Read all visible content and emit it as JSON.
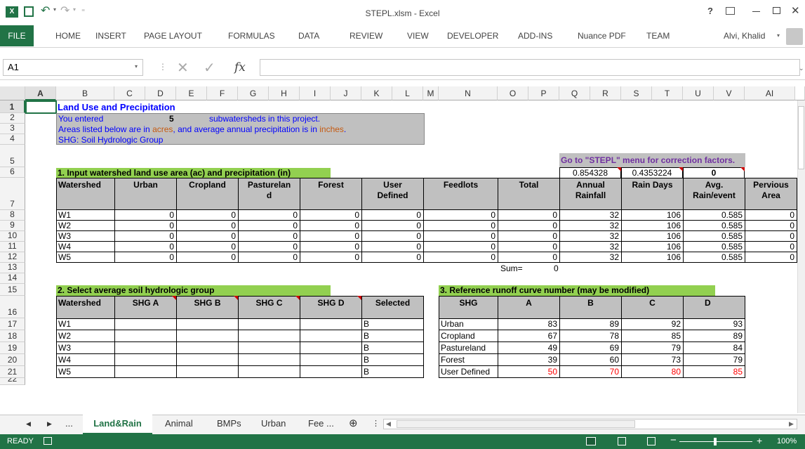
{
  "window": {
    "title": "STEPL.xlsm - Excel",
    "user": "Alvi, Khalid"
  },
  "ribbon": {
    "tabs": [
      "FILE",
      "HOME",
      "INSERT",
      "PAGE LAYOUT",
      "FORMULAS",
      "DATA",
      "REVIEW",
      "VIEW",
      "DEVELOPER",
      "ADD-INS",
      "Nuance PDF",
      "TEAM"
    ]
  },
  "formula_bar": {
    "name_box": "A1",
    "fx": "fx",
    "formula": ""
  },
  "columns": [
    "A",
    "B",
    "C",
    "D",
    "E",
    "F",
    "G",
    "H",
    "I",
    "J",
    "K",
    "L",
    "M",
    "N",
    "O",
    "P",
    "Q",
    "R",
    "S",
    "T",
    "U",
    "V",
    "AI"
  ],
  "rows": [
    "1",
    "2",
    "3",
    "4",
    "5",
    "6",
    "7",
    "8",
    "9",
    "10",
    "11",
    "12",
    "13",
    "14",
    "15",
    "16",
    "17",
    "18",
    "19",
    "20",
    "21",
    "22"
  ],
  "sheet": {
    "title": "Land Use and Precipitation",
    "entered_prefix": "You entered",
    "entered_count": "5",
    "entered_suffix": "subwatersheds in this project.",
    "areas_a": "Areas listed below are in ",
    "areas_b": "acres",
    "areas_c": ", and average annual precipitation is in ",
    "areas_d": "inches",
    "areas_e": ".",
    "shg_note": "SHG: Soil Hydrologic Group",
    "goto_note": "Go to \"STEPL\" menu for correction factors.",
    "factors": [
      "0.854328",
      "0.4353224",
      "0"
    ],
    "section1_title": "1. Input watershed land use area (ac) and precipitation",
    "section1_unit": "(in)",
    "t1_headers": [
      "Watershed",
      "Urban",
      "Cropland",
      "Pasturelan d",
      "Forest",
      "User Defined",
      "Feedlots",
      "Total",
      "Annual Rainfall",
      "Rain Days",
      "Avg. Rain/event",
      "Pervious Area"
    ],
    "t1_rows": [
      [
        "W1",
        "0",
        "0",
        "0",
        "0",
        "0",
        "0",
        "0",
        "32",
        "106",
        "0.585",
        "0"
      ],
      [
        "W2",
        "0",
        "0",
        "0",
        "0",
        "0",
        "0",
        "0",
        "32",
        "106",
        "0.585",
        "0"
      ],
      [
        "W3",
        "0",
        "0",
        "0",
        "0",
        "0",
        "0",
        "0",
        "32",
        "106",
        "0.585",
        "0"
      ],
      [
        "W4",
        "0",
        "0",
        "0",
        "0",
        "0",
        "0",
        "0",
        "32",
        "106",
        "0.585",
        "0"
      ],
      [
        "W5",
        "0",
        "0",
        "0",
        "0",
        "0",
        "0",
        "0",
        "32",
        "106",
        "0.585",
        "0"
      ]
    ],
    "sum_label": "Sum=",
    "sum_value": "0",
    "section2_title": "2. Select average soil hydrologic group",
    "t2_headers": [
      "Watershed",
      "SHG A",
      "SHG B",
      "SHG C",
      "SHG D",
      "Selected"
    ],
    "t2_rows": [
      [
        "W1",
        "B"
      ],
      [
        "W2",
        "B"
      ],
      [
        "W3",
        "B"
      ],
      [
        "W4",
        "B"
      ],
      [
        "W5",
        "B"
      ]
    ],
    "section3_title": "3. Reference runoff curve number (may be modified)",
    "t3_headers": [
      "SHG",
      "A",
      "B",
      "C",
      "D"
    ],
    "t3_rows": [
      [
        "Urban",
        "83",
        "89",
        "92",
        "93"
      ],
      [
        "Cropland",
        "67",
        "78",
        "85",
        "89"
      ],
      [
        "Pastureland",
        "49",
        "69",
        "79",
        "84"
      ],
      [
        "Forest",
        "39",
        "60",
        "73",
        "79"
      ],
      [
        "User Defined",
        "50",
        "70",
        "80",
        "85"
      ]
    ]
  },
  "sheet_tabs": [
    "...",
    "Land&Rain",
    "Animal",
    "BMPs",
    "Urban",
    "Fee ..."
  ],
  "status": {
    "ready": "READY",
    "zoom": "100%"
  },
  "colors": {
    "excel_green": "#217346",
    "header_gray": "#c0c0c0",
    "section_green": "#92d050",
    "title_blue": "#0000ff",
    "unit_brown": "#c55a11",
    "note_purple": "#7030a0",
    "user_red": "#ff0000"
  }
}
